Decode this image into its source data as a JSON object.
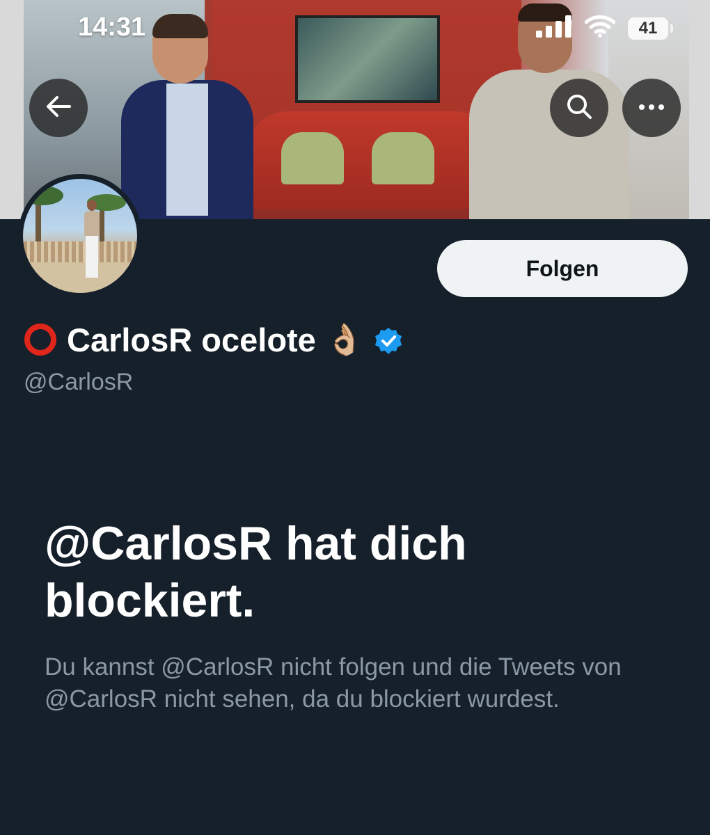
{
  "status_bar": {
    "time": "14:31",
    "battery": "41",
    "icons": [
      "cellular-signal-icon",
      "wifi-icon",
      "battery-icon"
    ]
  },
  "header": {
    "back_icon": "arrow-left-icon",
    "search_icon": "search-icon",
    "more_icon": "more-horizontal-icon"
  },
  "profile": {
    "display_name": "CarlosR ocelote",
    "name_prefix_icon": "red-ring-icon",
    "name_suffix_emoji": "👌🏼",
    "verified_icon": "verified-badge-icon",
    "handle": "@CarlosR",
    "follow_label": "Folgen"
  },
  "blocked": {
    "title": "@CarlosR hat dich blockiert.",
    "body": "Du kannst @CarlosR nicht folgen und die Tweets von @CarlosR nicht sehen, da du blockiert wurdest."
  },
  "colors": {
    "background": "#15202b",
    "primary_text": "#ffffff",
    "secondary_text": "#8b98a5",
    "follow_button_bg": "#eff3f4",
    "verified_blue": "#1d9bf0",
    "ring_red": "#e0251b"
  }
}
